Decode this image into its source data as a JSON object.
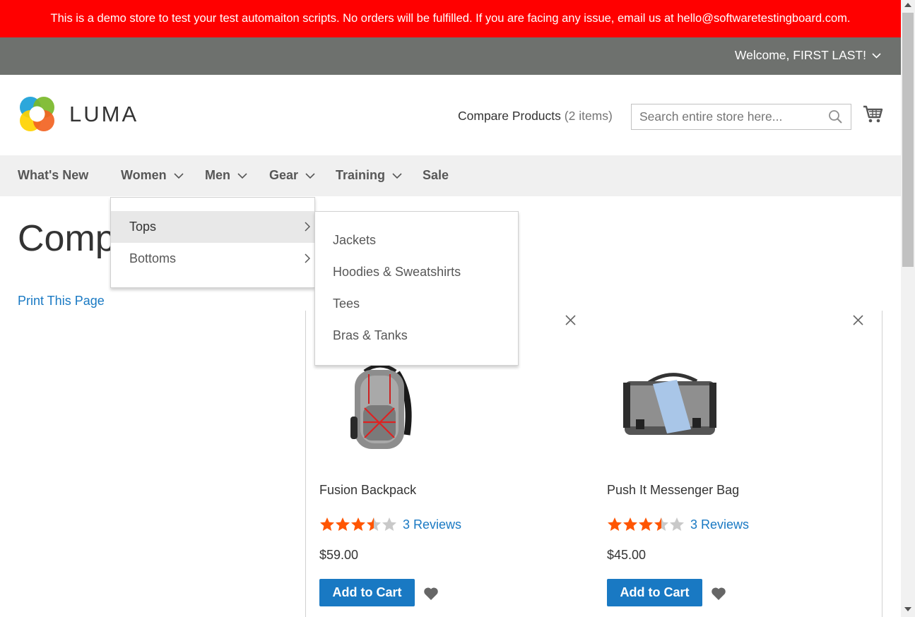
{
  "banner": {
    "text": "This is a demo store to test your test automaiton scripts. No orders will be fulfilled. If you are facing any issue, email us at hello@softwaretestingboard.com."
  },
  "topbar": {
    "welcome": "Welcome, FIRST LAST!"
  },
  "header": {
    "logo_text": "LUMA",
    "compare_label": "Compare Products",
    "compare_count": "(2 items)",
    "search_placeholder": "Search entire store here..."
  },
  "nav": {
    "items": [
      {
        "label": "What's New"
      },
      {
        "label": "Women"
      },
      {
        "label": "Men"
      },
      {
        "label": "Gear"
      },
      {
        "label": "Training"
      },
      {
        "label": "Sale"
      }
    ]
  },
  "women_menu": {
    "items": [
      {
        "label": "Tops"
      },
      {
        "label": "Bottoms"
      }
    ],
    "tops_submenu": [
      {
        "label": "Jackets"
      },
      {
        "label": "Hoodies & Sweatshirts"
      },
      {
        "label": "Tees"
      },
      {
        "label": "Bras & Tanks"
      }
    ]
  },
  "page": {
    "title": "Compare Products",
    "print_link": "Print This Page"
  },
  "products": [
    {
      "name": "Fusion Backpack",
      "rating": 3.5,
      "reviews": "3 Reviews",
      "price": "$59.00",
      "add_to_cart": "Add to Cart"
    },
    {
      "name": "Push It Messenger Bag",
      "rating": 3.5,
      "reviews": "3 Reviews",
      "price": "$45.00",
      "add_to_cart": "Add to Cart"
    }
  ],
  "colors": {
    "banner": "#ff0000",
    "topbar": "#6e716e",
    "accent": "#1979c3",
    "star": "#ff5501"
  }
}
